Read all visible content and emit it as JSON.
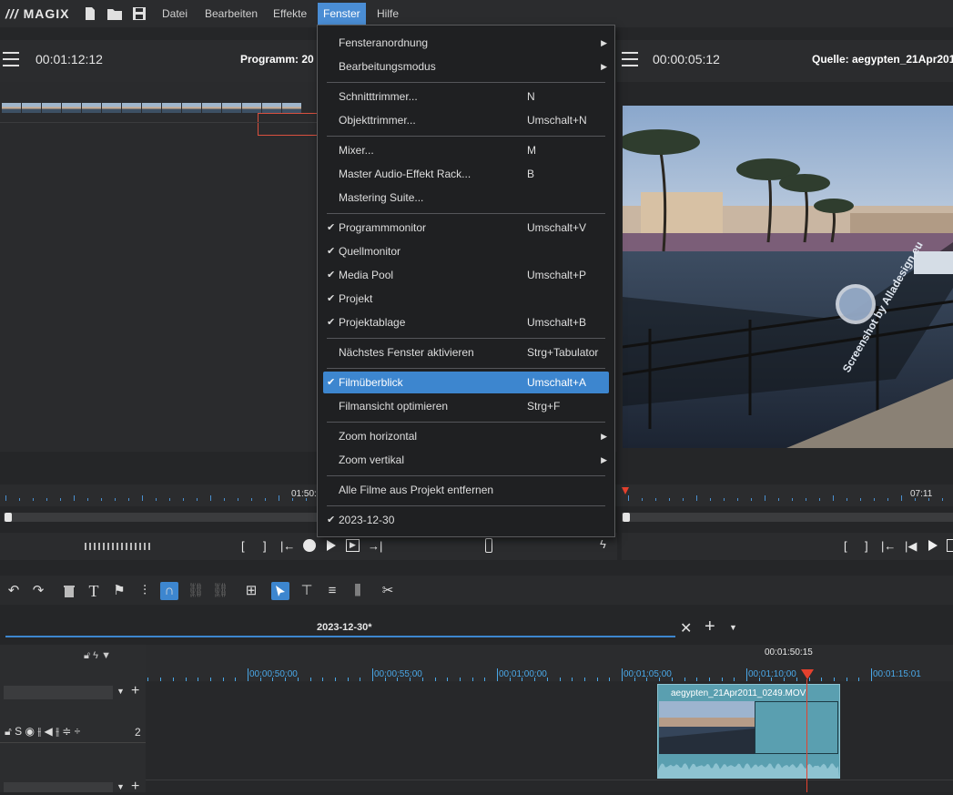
{
  "app": {
    "logo": "MAGIX"
  },
  "menubar": {
    "items": [
      "Datei",
      "Bearbeiten",
      "Effekte",
      "Fenster",
      "Hilfe"
    ],
    "active": "Fenster"
  },
  "program_monitor": {
    "timecode": "00:01:12:12",
    "title": "Programm: 20",
    "ruler_time": "01:50:"
  },
  "source_monitor": {
    "timecode": "00:00:05:12",
    "title": "Quelle: aegypten_21Apr201",
    "ruler_time": "07:11"
  },
  "watermark": {
    "text": "Screenshot by Alladesign.eu"
  },
  "dropdown": {
    "items": [
      {
        "label": "Fensteranordnung",
        "shortcut": "",
        "checked": false,
        "submenu": true
      },
      {
        "label": "Bearbeitungsmodus",
        "shortcut": "",
        "checked": false,
        "submenu": true
      },
      {
        "label": "Schnitttrimmer...",
        "shortcut": "N",
        "checked": false,
        "submenu": false
      },
      {
        "label": "Objekttrimmer...",
        "shortcut": "Umschalt+N",
        "checked": false,
        "submenu": false
      },
      {
        "label": "Mixer...",
        "shortcut": "M",
        "checked": false,
        "submenu": false
      },
      {
        "label": "Master Audio-Effekt Rack...",
        "shortcut": "B",
        "checked": false,
        "submenu": false
      },
      {
        "label": "Mastering Suite...",
        "shortcut": "",
        "checked": false,
        "submenu": false
      },
      {
        "label": "Programmmonitor",
        "shortcut": "Umschalt+V",
        "checked": true,
        "submenu": false
      },
      {
        "label": "Quellmonitor",
        "shortcut": "",
        "checked": true,
        "submenu": false
      },
      {
        "label": "Media Pool",
        "shortcut": "Umschalt+P",
        "checked": true,
        "submenu": false
      },
      {
        "label": "Projekt",
        "shortcut": "",
        "checked": true,
        "submenu": false
      },
      {
        "label": "Projektablage",
        "shortcut": "Umschalt+B",
        "checked": true,
        "submenu": false
      },
      {
        "label": "Nächstes Fenster aktivieren",
        "shortcut": "Strg+Tabulator",
        "checked": false,
        "submenu": false
      },
      {
        "label": "Filmüberblick",
        "shortcut": "Umschalt+A",
        "checked": true,
        "submenu": false,
        "highlighted": true
      },
      {
        "label": "Filmansicht optimieren",
        "shortcut": "Strg+F",
        "checked": false,
        "submenu": false
      },
      {
        "label": "Zoom horizontal",
        "shortcut": "",
        "checked": false,
        "submenu": true
      },
      {
        "label": "Zoom vertikal",
        "shortcut": "",
        "checked": false,
        "submenu": true
      },
      {
        "label": "Alle Filme aus Projekt entfernen",
        "shortcut": "",
        "checked": false,
        "submenu": false
      },
      {
        "label": "2023-12-30",
        "shortcut": "",
        "checked": true,
        "submenu": false
      }
    ]
  },
  "timeline": {
    "tab": "2023-12-30*",
    "playhead_time": "00:01:50:15",
    "ticks": [
      "00:00:50:00",
      "00:00:55:00",
      "00:01:00:00",
      "00:01:05:00",
      "00:01:10:00",
      "00:01:15:01"
    ],
    "track_number": "2",
    "clip_name": "aegypten_21Apr2011_0249.MOV",
    "track_controls": "S"
  },
  "colors": {
    "accent": "#3d86cf",
    "playhead": "#e5412e",
    "clip": "#5a9fb0"
  }
}
